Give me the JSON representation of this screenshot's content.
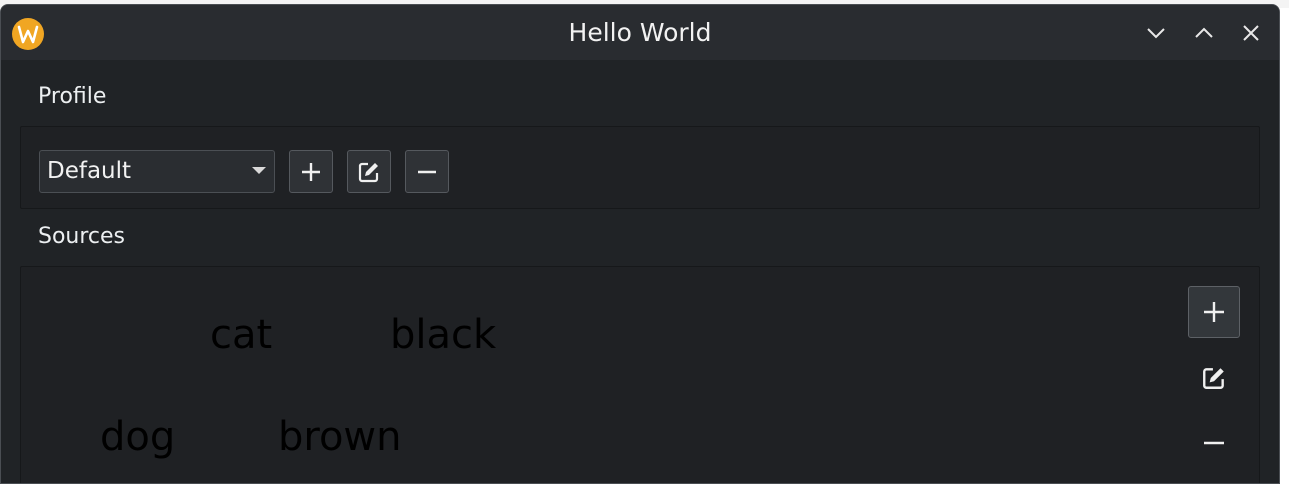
{
  "window": {
    "title": "Hello World",
    "controls": [
      "minimize",
      "maximize",
      "close"
    ]
  },
  "profile": {
    "section_label": "Profile",
    "selected": "Default",
    "buttons": [
      "add-icon",
      "edit-icon",
      "remove-icon"
    ]
  },
  "sources": {
    "section_label": "Sources",
    "items": [
      {
        "name": "cat",
        "color": "black"
      },
      {
        "name": "dog",
        "color": "brown"
      }
    ],
    "buttons": [
      "add-icon",
      "edit-icon",
      "remove-icon"
    ]
  },
  "colors": {
    "window_bg": "#202326",
    "titlebar_bg": "#292c30",
    "app_icon": "#f0a623",
    "text": "#f2f2f2",
    "source_text": "#000000"
  }
}
